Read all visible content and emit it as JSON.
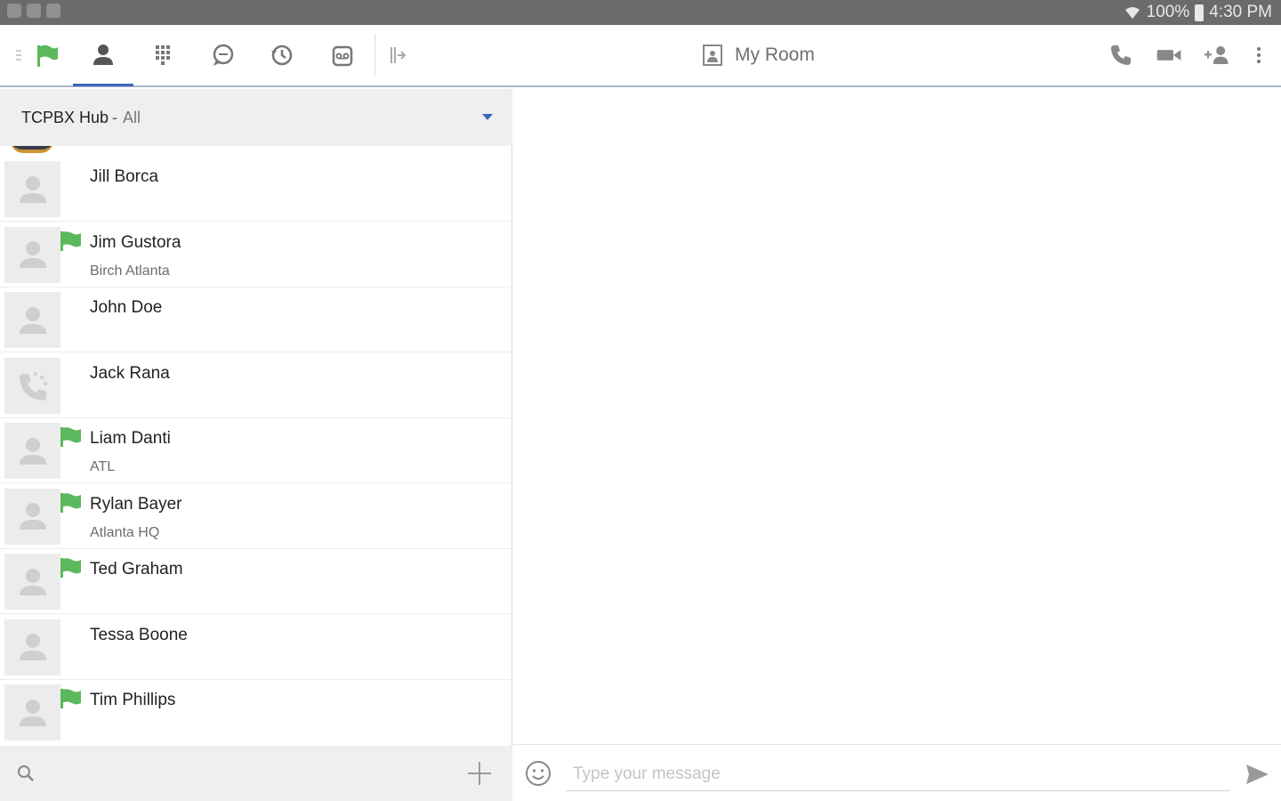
{
  "status_bar": {
    "battery": "100%",
    "time": "4:30 PM"
  },
  "toolbar": {
    "room_title": "My Room",
    "accent_color": "#3d67b8",
    "presence_color": "#5cb85c"
  },
  "hub": {
    "name": "TCPBX Hub",
    "separator": "-",
    "filter": "All"
  },
  "contacts": [
    {
      "name": "Jill Borca",
      "subtitle": "",
      "flag": false,
      "avatar": "person-icon"
    },
    {
      "name": "Jim Gustora",
      "subtitle": "Birch Atlanta",
      "flag": true,
      "avatar": "person-icon"
    },
    {
      "name": "John Doe",
      "subtitle": "",
      "flag": false,
      "avatar": "person-icon"
    },
    {
      "name": "Jack Rana",
      "subtitle": "",
      "flag": false,
      "avatar": "phone-icon"
    },
    {
      "name": "Liam Danti",
      "subtitle": "ATL",
      "flag": true,
      "avatar": "person-icon"
    },
    {
      "name": "Rylan Bayer",
      "subtitle": "Atlanta HQ",
      "flag": true,
      "avatar": "person-icon"
    },
    {
      "name": "Ted Graham",
      "subtitle": "",
      "flag": true,
      "avatar": "person-icon"
    },
    {
      "name": "Tessa Boone",
      "subtitle": "",
      "flag": false,
      "avatar": "person-icon"
    },
    {
      "name": "Tim Phillips",
      "subtitle": "",
      "flag": true,
      "avatar": "person-icon"
    }
  ],
  "compose": {
    "placeholder": "Type your message"
  }
}
